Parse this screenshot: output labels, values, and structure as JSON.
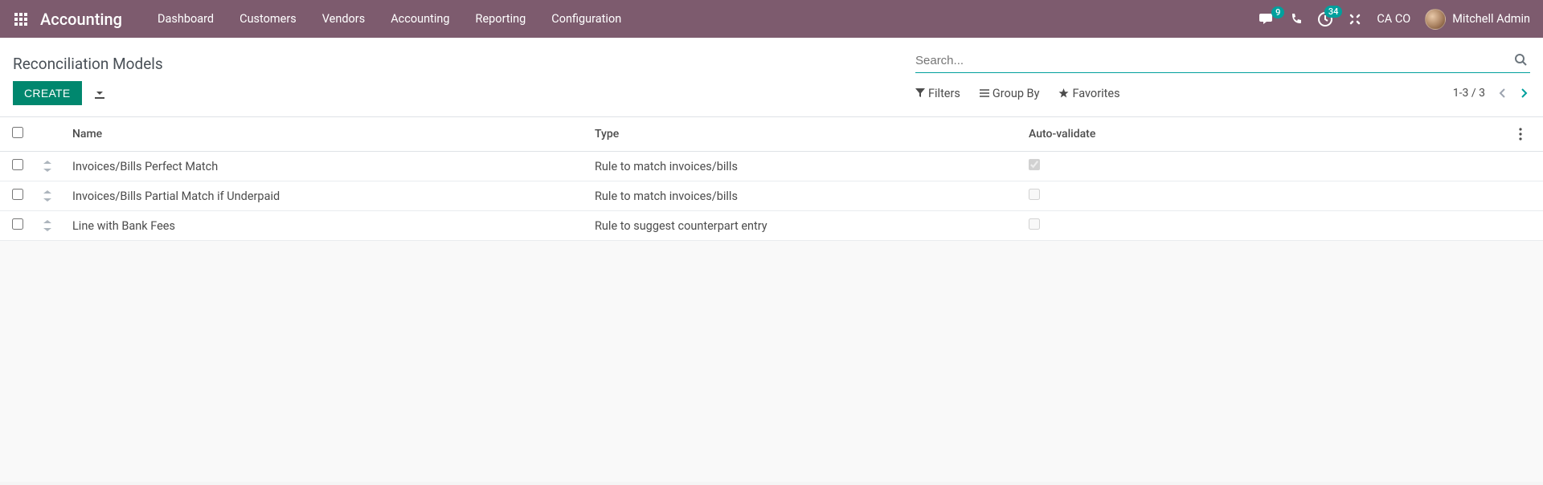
{
  "topnav": {
    "brand": "Accounting",
    "menu": [
      "Dashboard",
      "Customers",
      "Vendors",
      "Accounting",
      "Reporting",
      "Configuration"
    ],
    "messages_badge": "9",
    "activities_badge": "34",
    "company": "CA CO",
    "user": "Mitchell Admin"
  },
  "breadcrumb": "Reconciliation Models",
  "buttons": {
    "create": "CREATE"
  },
  "search": {
    "placeholder": "Search...",
    "filters": "Filters",
    "groupby": "Group By",
    "favorites": "Favorites"
  },
  "pager": {
    "text": "1-3 / 3"
  },
  "table": {
    "cols": {
      "name": "Name",
      "type": "Type",
      "auto": "Auto-validate"
    },
    "rows": [
      {
        "name": "Invoices/Bills Perfect Match",
        "type": "Rule to match invoices/bills",
        "auto": true
      },
      {
        "name": "Invoices/Bills Partial Match if Underpaid",
        "type": "Rule to match invoices/bills",
        "auto": false
      },
      {
        "name": "Line with Bank Fees",
        "type": "Rule to suggest counterpart entry",
        "auto": false
      }
    ]
  }
}
